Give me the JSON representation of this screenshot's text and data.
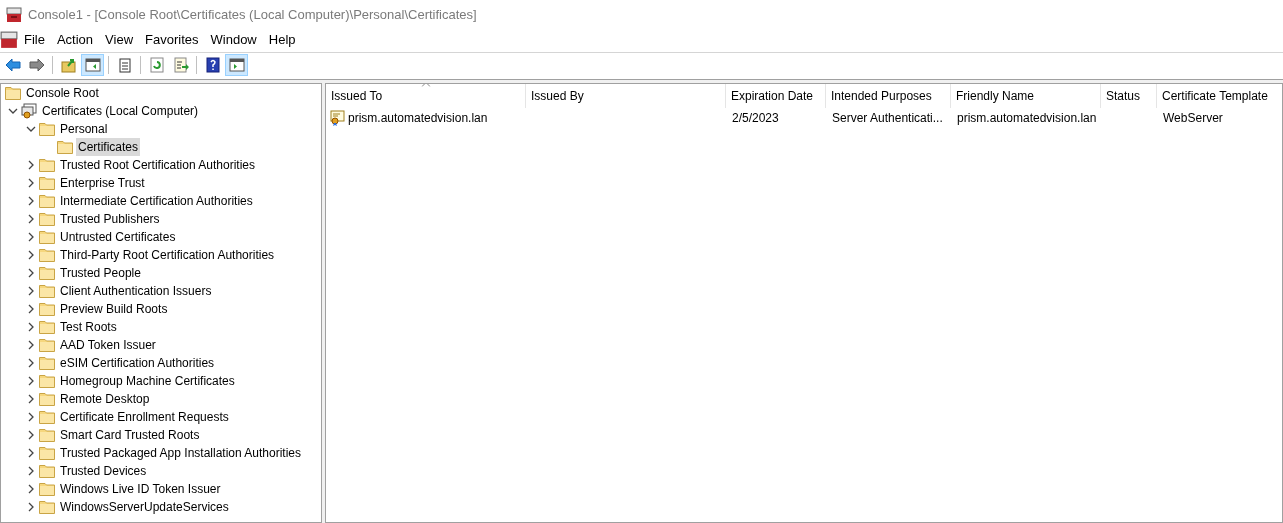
{
  "window": {
    "title": "Console1 - [Console Root\\Certificates (Local Computer)\\Personal\\Certificates]"
  },
  "menu": [
    "File",
    "Action",
    "View",
    "Favorites",
    "Window",
    "Help"
  ],
  "toolbar": [
    {
      "kind": "back",
      "on": false
    },
    {
      "kind": "forward",
      "on": false
    },
    {
      "kind": "sep"
    },
    {
      "kind": "up",
      "on": false
    },
    {
      "kind": "tree",
      "on": true
    },
    {
      "kind": "sep"
    },
    {
      "kind": "clipboard",
      "on": false
    },
    {
      "kind": "sep"
    },
    {
      "kind": "refresh",
      "on": false
    },
    {
      "kind": "export",
      "on": false
    },
    {
      "kind": "sep"
    },
    {
      "kind": "help",
      "on": false
    },
    {
      "kind": "action",
      "on": true
    }
  ],
  "tree": [
    {
      "label": "Console Root",
      "kind": "folder",
      "selected": false,
      "children": [
        {
          "label": "Certificates (Local Computer)",
          "kind": "snapin",
          "selected": false,
          "expanded": true,
          "children": [
            {
              "label": "Personal",
              "kind": "folder",
              "selected": false,
              "expanded": true,
              "children": [
                {
                  "label": "Certificates",
                  "kind": "folder",
                  "selected": true
                }
              ]
            },
            {
              "label": "Trusted Root Certification Authorities",
              "kind": "folder",
              "selected": false,
              "expanded": false
            },
            {
              "label": "Enterprise Trust",
              "kind": "folder",
              "selected": false,
              "expanded": false
            },
            {
              "label": "Intermediate Certification Authorities",
              "kind": "folder",
              "selected": false,
              "expanded": false
            },
            {
              "label": "Trusted Publishers",
              "kind": "folder",
              "selected": false,
              "expanded": false
            },
            {
              "label": "Untrusted Certificates",
              "kind": "folder",
              "selected": false,
              "expanded": false
            },
            {
              "label": "Third-Party Root Certification Authorities",
              "kind": "folder",
              "selected": false,
              "expanded": false
            },
            {
              "label": "Trusted People",
              "kind": "folder",
              "selected": false,
              "expanded": false
            },
            {
              "label": "Client Authentication Issuers",
              "kind": "folder",
              "selected": false,
              "expanded": false
            },
            {
              "label": "Preview Build Roots",
              "kind": "folder",
              "selected": false,
              "expanded": false
            },
            {
              "label": "Test Roots",
              "kind": "folder",
              "selected": false,
              "expanded": false
            },
            {
              "label": "AAD Token Issuer",
              "kind": "folder",
              "selected": false,
              "expanded": false
            },
            {
              "label": "eSIM Certification Authorities",
              "kind": "folder",
              "selected": false,
              "expanded": false
            },
            {
              "label": "Homegroup Machine Certificates",
              "kind": "folder",
              "selected": false,
              "expanded": false
            },
            {
              "label": "Remote Desktop",
              "kind": "folder",
              "selected": false,
              "expanded": false
            },
            {
              "label": "Certificate Enrollment Requests",
              "kind": "folder",
              "selected": false,
              "expanded": false
            },
            {
              "label": "Smart Card Trusted Roots",
              "kind": "folder",
              "selected": false,
              "expanded": false
            },
            {
              "label": "Trusted Packaged App Installation Authorities",
              "kind": "folder",
              "selected": false,
              "expanded": false
            },
            {
              "label": "Trusted Devices",
              "kind": "folder",
              "selected": false,
              "expanded": false
            },
            {
              "label": "Windows Live ID Token Issuer",
              "kind": "folder",
              "selected": false,
              "expanded": false
            },
            {
              "label": "WindowsServerUpdateServices",
              "kind": "folder",
              "selected": false,
              "expanded": false
            }
          ]
        }
      ]
    }
  ],
  "table": {
    "columns": [
      {
        "label": "Issued To",
        "sorted": true
      },
      {
        "label": "Issued By",
        "sorted": false
      },
      {
        "label": "Expiration Date",
        "sorted": false
      },
      {
        "label": "Intended Purposes",
        "sorted": false
      },
      {
        "label": "Friendly Name",
        "sorted": false
      },
      {
        "label": "Status",
        "sorted": false
      },
      {
        "label": "Certificate Template",
        "sorted": false
      }
    ],
    "rows": [
      {
        "cells": [
          "prism.automatedvision.lan",
          "",
          "2/5/2023",
          "Server Authenticati...",
          "prism.automatedvision.lan",
          "",
          "WebServer"
        ]
      }
    ]
  }
}
